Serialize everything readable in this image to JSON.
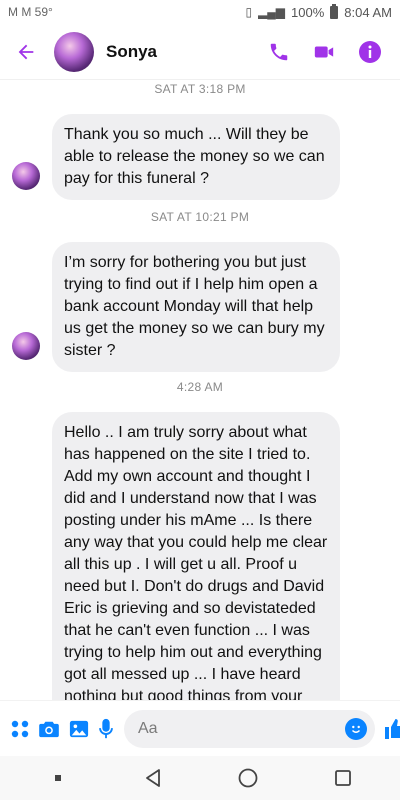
{
  "status_bar": {
    "carrier_icons": "M M 59°",
    "battery_percent": "100%",
    "time": "8:04 AM"
  },
  "header": {
    "contact_name": "Sonya"
  },
  "messages": [
    {
      "timestamp": "SAT AT 3:18 PM",
      "text": "Thank you so much ... Will they be able to release the money so we can pay for this funeral ?"
    },
    {
      "timestamp": "SAT AT 10:21 PM",
      "text": "I’m sorry for bothering you but just trying to find out if I help him open a bank account Monday will that help us get the money so we can bury my sister ?"
    },
    {
      "timestamp": "4:28 AM",
      "text": "Hello .. I am truly sorry about what has happened on the site I tried to. Add my own account and thought I did and I understand now that I was posting under his mAme ... Is there any way that you could help me clear all this up . I will get u all. Proof u need but I. Don't do drugs and David Eric is grieving and so devistateded that  he can't even function ... I was trying to help him out and everything got all messed up ... I have heard nothing but good things from your site and wanted"
    }
  ],
  "composer": {
    "placeholder": "Aa"
  },
  "colors": {
    "accent_purple": "#a033e8",
    "messenger_blue": "#0a84ff",
    "bubble_gray": "#efeff1"
  },
  "icons": {
    "header": [
      "back-arrow-icon",
      "phone-icon",
      "video-camera-icon",
      "info-icon"
    ],
    "composer": [
      "apps-grid-icon",
      "camera-icon",
      "gallery-icon",
      "microphone-icon",
      "emoji-icon",
      "thumbs-up-icon"
    ],
    "navigation": [
      "recents-icon",
      "back-icon",
      "home-icon",
      "overview-icon"
    ]
  }
}
